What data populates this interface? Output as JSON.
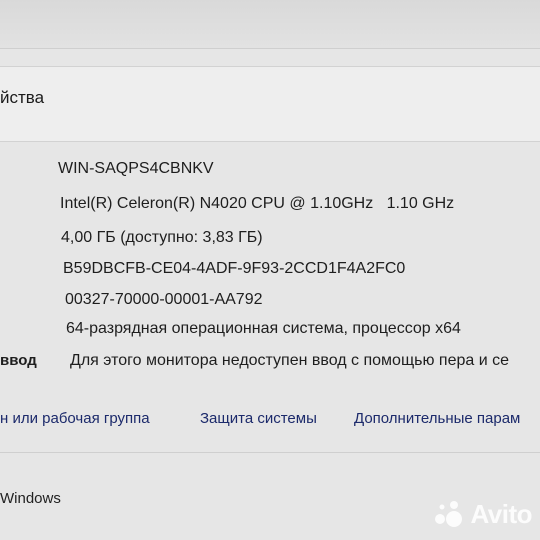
{
  "section": {
    "title": "йства"
  },
  "specs": [
    {
      "label": "",
      "value": "WIN-SAQPS4CBNKV"
    },
    {
      "label": "",
      "value": "Intel(R) Celeron(R) N4020 CPU @ 1.10GHz   1.10 GHz"
    },
    {
      "label": "",
      "value": "4,00 ГБ (доступно: 3,83 ГБ)"
    },
    {
      "label": "",
      "value": "B59DBCFB-CE04-4ADF-9F93-2CCD1F4A2FC0"
    },
    {
      "label": "",
      "value": "00327-70000-00001-AA792"
    },
    {
      "label": "",
      "value": "64-разрядная операционная система, процессор x64"
    },
    {
      "label": "ввод",
      "value": "Для этого монитора недоступен ввод с помощью пера и се"
    }
  ],
  "links": {
    "domain": "н или рабочая группа",
    "protection": "Защита системы",
    "advanced": "Дополнительные парам"
  },
  "footer": {
    "text": "Windows"
  },
  "watermark": {
    "text": "Avito"
  }
}
